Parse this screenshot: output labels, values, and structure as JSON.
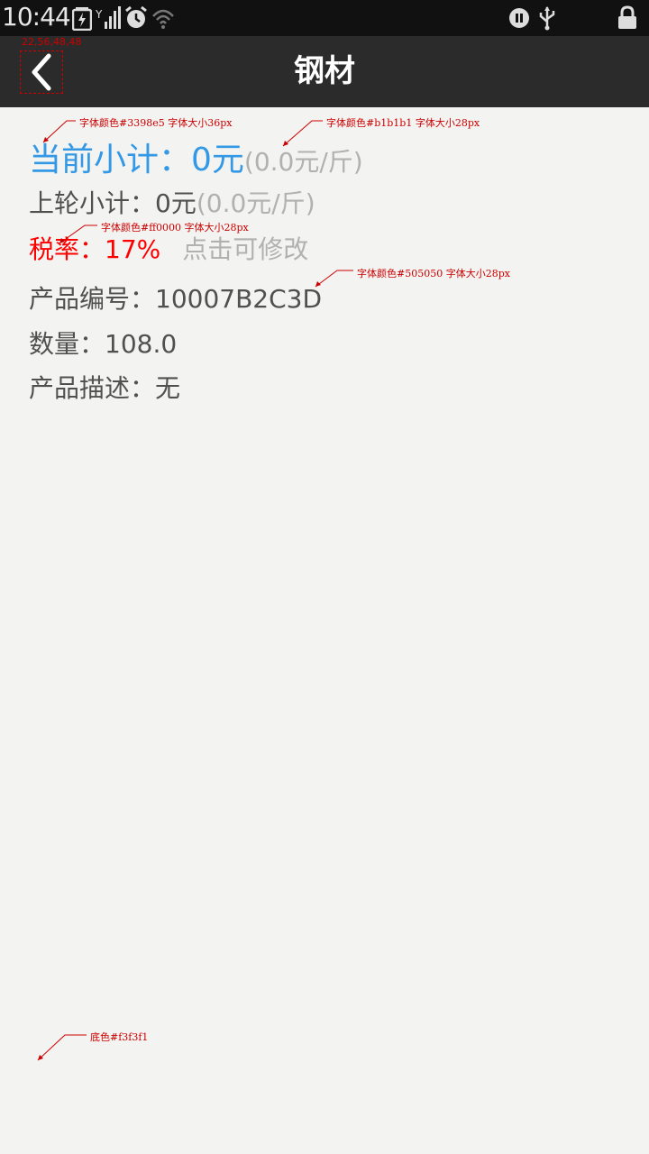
{
  "status_bar": {
    "time": "10:44"
  },
  "title_bar": {
    "title": "钢材"
  },
  "rows": {
    "current_subtotal_label": "当前小计：",
    "current_subtotal_value": "0元",
    "current_subtotal_unit": "(0.0元/斤)",
    "prev_subtotal_label": "上轮小计：",
    "prev_subtotal_value": "0元",
    "prev_subtotal_unit": "(0.0元/斤)",
    "tax_label": "税率：",
    "tax_value": "17%",
    "tax_edit_hint": "点击可修改",
    "product_no": "产品编号：10007B2C3D",
    "quantity": "数量：108.0",
    "description": "产品描述：无"
  },
  "annotations": {
    "back_dims": "22,56,48,48",
    "blue_note": "字体颜色#3398e5   字体大小36px",
    "grey_note": "字体颜色#b1b1b1   字体大小28px",
    "red_note": "字体颜色#ff0000   字体大小28px",
    "dark_note": "字体颜色#505050   字体大小28px",
    "bg_note": "底色#f3f3f1"
  },
  "colors": {
    "blue": "#3398e5",
    "grey": "#b1b1b1",
    "red": "#ff0000",
    "dark": "#505050",
    "background": "#f3f3f1"
  }
}
